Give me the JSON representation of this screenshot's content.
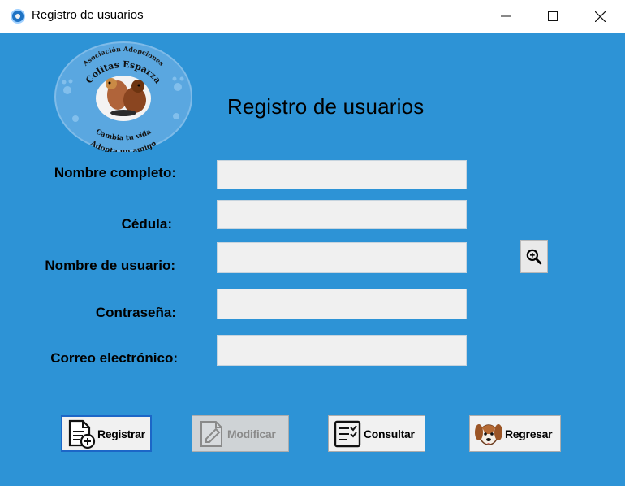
{
  "window": {
    "title": "Registro de usuarios",
    "controls": {
      "minimize": "minimize",
      "maximize": "maximize",
      "close": "close"
    }
  },
  "logo": {
    "top_text": "Asociación Adopciones",
    "name": "Colitas Esparza",
    "bottom_text_1": "Cambia tu vida",
    "bottom_text_2": "Adopta un amigo"
  },
  "form": {
    "heading": "Registro de usuarios",
    "fields": [
      {
        "label": "Nombre completo:",
        "value": ""
      },
      {
        "label": "Cédula:",
        "value": ""
      },
      {
        "label": "Nombre de usuario:",
        "value": ""
      },
      {
        "label": "Contraseña:",
        "value": ""
      },
      {
        "label": "Correo electrónico:",
        "value": ""
      }
    ],
    "search_icon": "zoom-in-icon"
  },
  "actions": {
    "registrar": "Registrar",
    "modificar": "Modificar",
    "consultar": "Consultar",
    "regresar": "Regresar"
  },
  "colors": {
    "background": "#2d93d6",
    "input_bg": "#f0f0f0",
    "button_bg": "#f1f1f1",
    "disabled_button_bg": "#cfd3d6",
    "focus_border": "#1c66c7"
  }
}
